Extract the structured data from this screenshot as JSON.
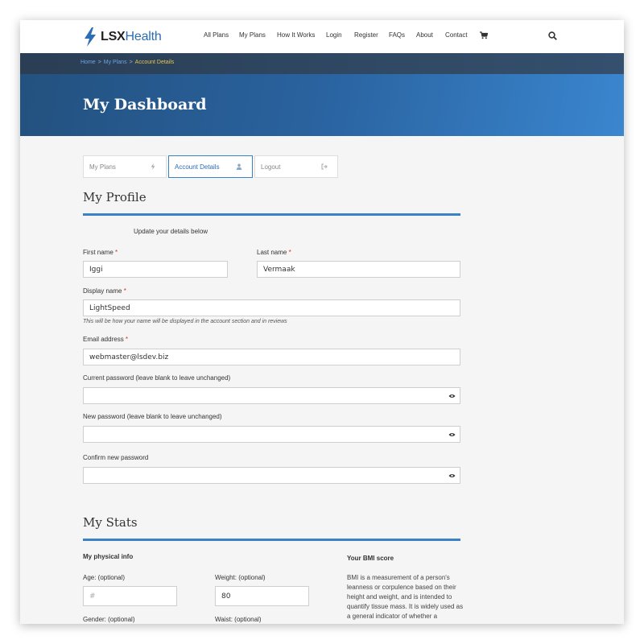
{
  "header": {
    "logo": {
      "part1": "LSX",
      "part2": "Health"
    },
    "nav": [
      "All Plans",
      "My Plans",
      "How It Works",
      "Login",
      "Register",
      "FAQs",
      "About",
      "Contact"
    ],
    "icons": {
      "cart": "cart-icon",
      "search": "search-icon"
    }
  },
  "breadcrumb": {
    "home": "Home",
    "sep": ">",
    "plans": "My Plans",
    "current": "Account Details"
  },
  "hero": {
    "title": "My Dashboard"
  },
  "tabs": [
    {
      "label": "My Plans",
      "icon": "bolt-icon"
    },
    {
      "label": "Account Details",
      "icon": "user-icon",
      "active": true
    },
    {
      "label": "Logout",
      "icon": "sign-out-icon"
    }
  ],
  "profile": {
    "title": "My Profile",
    "intro": "Update your details below",
    "required_mark": "*",
    "first_name": {
      "label": "First name",
      "value": "Iggi"
    },
    "last_name": {
      "label": "Last name",
      "value": "Vermaak"
    },
    "display_name": {
      "label": "Display name",
      "value": "LightSpeed",
      "hint": "This will be how your name will be displayed in the account section and in reviews"
    },
    "email": {
      "label": "Email address",
      "value": "webmaster@lsdev.biz"
    },
    "current_password": {
      "label": "Current password (leave blank to leave unchanged)",
      "value": ""
    },
    "new_password": {
      "label": "New password (leave blank to leave unchanged)",
      "value": ""
    },
    "confirm_password": {
      "label": "Confirm new password",
      "value": ""
    }
  },
  "stats": {
    "title": "My Stats",
    "physical_heading": "My physical info",
    "bmi_heading": "Your BMI score",
    "age": {
      "label": "Age: (optional)",
      "placeholder": "#"
    },
    "weight": {
      "label": "Weight: (optional)",
      "value": "80"
    },
    "gender": {
      "label": "Gender: (optional)"
    },
    "waist": {
      "label": "Waist: (optional)"
    },
    "bmi_text": "BMI is a measurement of a person's leanness or corpulence based on their height and weight, and is intended to quantify tissue mass. It is widely used as a general indicator of whether a"
  },
  "colors": {
    "accent": "#3b82c4",
    "link": "#2d6db5",
    "breadcrumb_current": "#e5c34a",
    "required": "#d23030",
    "hero_start": "#23517f",
    "hero_end": "#3a86cf"
  }
}
